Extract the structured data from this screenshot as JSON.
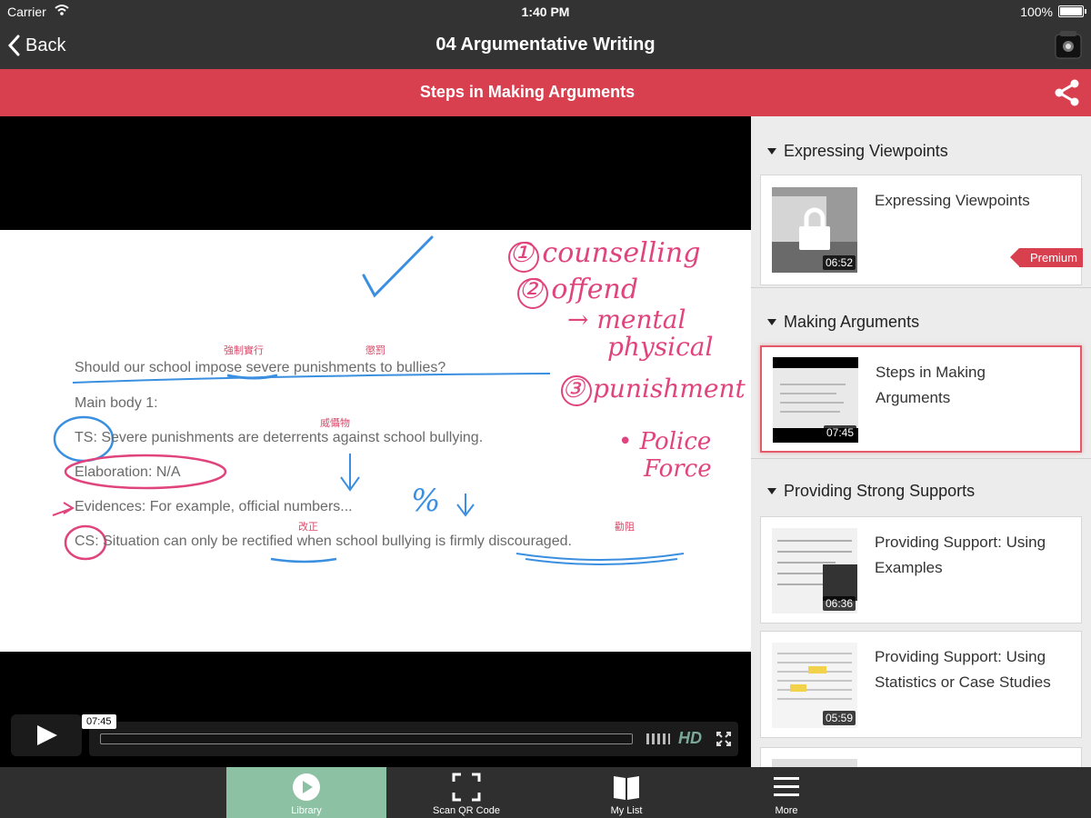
{
  "status": {
    "carrier": "Carrier",
    "time": "1:40 PM",
    "battery": "100%"
  },
  "nav": {
    "back_label": "Back",
    "title": "04 Argumentative Writing"
  },
  "header": {
    "title": "Steps in Making Arguments"
  },
  "slide": {
    "question": "Should our school impose severe punishments to bullies?",
    "main_body": "Main body 1:",
    "ts": "TS: Severe punishments are deterrents against school bullying.",
    "elaboration": "Elaboration: N/A",
    "evidences": "Evidences: For example, official numbers...",
    "cs": "CS: Situation can only be rectified when school bullying is firmly discouraged.",
    "annotations_cn": [
      "強制實行",
      "懲罰",
      "威懾物",
      "改正",
      "勸阻"
    ],
    "handwriting": {
      "n1": "① counselling",
      "n2": "② offend",
      "n2a": "→ mental",
      "n2b": "physical",
      "n3": "③ punishment",
      "n3a": "• Police",
      "n3b": "Force",
      "percent": "%"
    }
  },
  "player": {
    "current_time": "07:45",
    "hd": "HD"
  },
  "sidebar": {
    "sections": [
      {
        "title": "Expressing Viewpoints",
        "items": [
          {
            "title": "Expressing Viewpoints",
            "duration": "06:52",
            "badge": "Premium",
            "locked": true
          }
        ]
      },
      {
        "title": "Making Arguments",
        "items": [
          {
            "title": "Steps in Making Arguments",
            "duration": "07:45",
            "active": true
          }
        ]
      },
      {
        "title": "Providing Strong Supports",
        "items": [
          {
            "title": "Providing Support: Using Examples",
            "duration": "06:36"
          },
          {
            "title": "Providing Support: Using Statistics or Case Studies",
            "duration": "05:59"
          }
        ]
      }
    ]
  },
  "tabs": [
    {
      "label": "Library",
      "icon": "play-circle-icon",
      "active": true
    },
    {
      "label": "Scan QR Code",
      "icon": "scan-frame-icon"
    },
    {
      "label": "My List",
      "icon": "book-icon"
    },
    {
      "label": "More",
      "icon": "menu-icon"
    }
  ],
  "colors": {
    "accent_red": "#d9404f",
    "tab_active": "#8cc1a3",
    "bar_dark": "#333333"
  }
}
